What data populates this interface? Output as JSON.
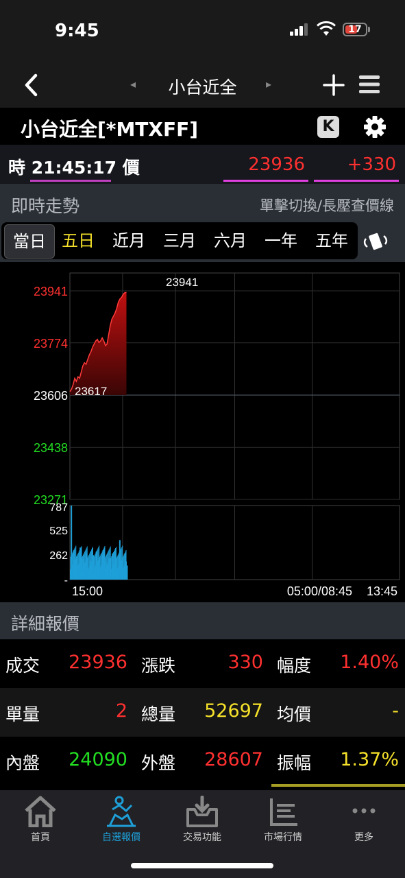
{
  "status": {
    "time": "9:45",
    "battery": "17"
  },
  "nav": {
    "title": "小台近全",
    "prev": "◂",
    "next": "▸"
  },
  "product": {
    "title": "小台近全[*MTXFF]",
    "k_label": "K"
  },
  "quote": {
    "time_label": "時 21:45:17 價",
    "price": "23936",
    "change": "+330"
  },
  "trend": {
    "title": "即時走勢",
    "hint": "單擊切換/長壓查價線"
  },
  "tabs": [
    "當日",
    "五日",
    "近月",
    "三月",
    "六月",
    "一年",
    "五年"
  ],
  "colors": {
    "up": "#ff3030",
    "down": "#22dd22",
    "accent": "#1e9fd8",
    "highlight": "#f5e12a"
  },
  "chart_data": {
    "type": "area",
    "price_axis": {
      "ticks": [
        "23941",
        "23774",
        "23606",
        "23438",
        "23271"
      ],
      "ylim": [
        23271,
        23941
      ],
      "reference": 23606
    },
    "max_label": "23941",
    "min_label": "23617",
    "volume_axis": {
      "ticks": [
        "787",
        "525",
        "262",
        "-"
      ],
      "ylim": [
        0,
        787
      ]
    },
    "x_ticks": [
      "15:00",
      "05:00/08:45",
      "13:45"
    ],
    "price_series": [
      [
        0,
        23617
      ],
      [
        0.01,
        23625
      ],
      [
        0.02,
        23640
      ],
      [
        0.03,
        23660
      ],
      [
        0.04,
        23650
      ],
      [
        0.05,
        23665
      ],
      [
        0.06,
        23660
      ],
      [
        0.07,
        23680
      ],
      [
        0.08,
        23700
      ],
      [
        0.09,
        23710
      ],
      [
        0.1,
        23705
      ],
      [
        0.11,
        23720
      ],
      [
        0.12,
        23735
      ],
      [
        0.13,
        23745
      ],
      [
        0.14,
        23760
      ],
      [
        0.15,
        23770
      ],
      [
        0.16,
        23780
      ],
      [
        0.17,
        23785
      ],
      [
        0.18,
        23775
      ],
      [
        0.19,
        23780
      ],
      [
        0.2,
        23790
      ],
      [
        0.21,
        23780
      ],
      [
        0.22,
        23765
      ],
      [
        0.23,
        23770
      ],
      [
        0.24,
        23800
      ],
      [
        0.25,
        23830
      ],
      [
        0.26,
        23850
      ],
      [
        0.27,
        23860
      ],
      [
        0.28,
        23870
      ],
      [
        0.29,
        23885
      ],
      [
        0.3,
        23905
      ],
      [
        0.31,
        23915
      ],
      [
        0.32,
        23920
      ],
      [
        0.33,
        23930
      ],
      [
        0.34,
        23935
      ],
      [
        0.35,
        23936
      ]
    ],
    "volume_series": [
      [
        0.005,
        787
      ],
      [
        0.02,
        310
      ],
      [
        0.04,
        250
      ],
      [
        0.06,
        340
      ],
      [
        0.08,
        220
      ],
      [
        0.1,
        280
      ],
      [
        0.12,
        200
      ],
      [
        0.14,
        260
      ],
      [
        0.16,
        300
      ],
      [
        0.18,
        240
      ],
      [
        0.2,
        260
      ],
      [
        0.22,
        190
      ],
      [
        0.24,
        230
      ],
      [
        0.26,
        280
      ],
      [
        0.28,
        210
      ],
      [
        0.3,
        270
      ],
      [
        0.305,
        420
      ],
      [
        0.32,
        230
      ],
      [
        0.34,
        250
      ],
      [
        0.35,
        150
      ]
    ]
  },
  "detail": {
    "title": "詳細報價",
    "rows": [
      [
        {
          "label": "成交",
          "value": "23936",
          "color": "#ff3030"
        },
        {
          "label": "漲跌",
          "value": "330",
          "color": "#ff3030"
        },
        {
          "label": "幅度",
          "value": "1.40%",
          "color": "#ff3030"
        }
      ],
      [
        {
          "label": "單量",
          "value": "2",
          "color": "#ff3030"
        },
        {
          "label": "總量",
          "value": "52697",
          "color": "#f5e12a"
        },
        {
          "label": "均價",
          "value": "-",
          "color": "#f5e12a"
        }
      ],
      [
        {
          "label": "內盤",
          "value": "24090",
          "color": "#22dd22"
        },
        {
          "label": "外盤",
          "value": "28607",
          "color": "#ff3030"
        },
        {
          "label": "振幅",
          "value": "1.37%",
          "color": "#f5e12a"
        }
      ]
    ]
  },
  "tabbar": [
    {
      "label": "首頁",
      "icon": "home-icon"
    },
    {
      "label": "自選報價",
      "icon": "favorites-icon"
    },
    {
      "label": "交易功能",
      "icon": "trade-icon"
    },
    {
      "label": "市場行情",
      "icon": "market-icon"
    },
    {
      "label": "更多",
      "icon": "more-icon"
    }
  ]
}
